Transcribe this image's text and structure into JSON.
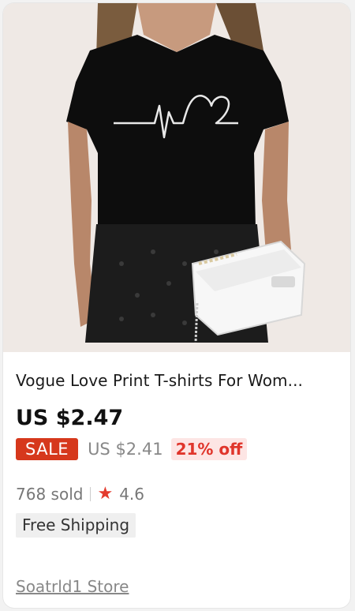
{
  "product": {
    "image_alt": "black t-shirt heartbeat print",
    "title": "Vogue Love Print T-shirts For Wom...",
    "price": "US $2.47",
    "sale_label": "SALE",
    "original_price": "US $2.41",
    "discount": "21% off",
    "sold": "768 sold",
    "rating": "4.6",
    "shipping": "Free Shipping",
    "store": "Soatrld1 Store"
  },
  "colors": {
    "sale_badge": "#d6381c",
    "discount_text": "#e0352b",
    "star": "#e33b2e"
  }
}
